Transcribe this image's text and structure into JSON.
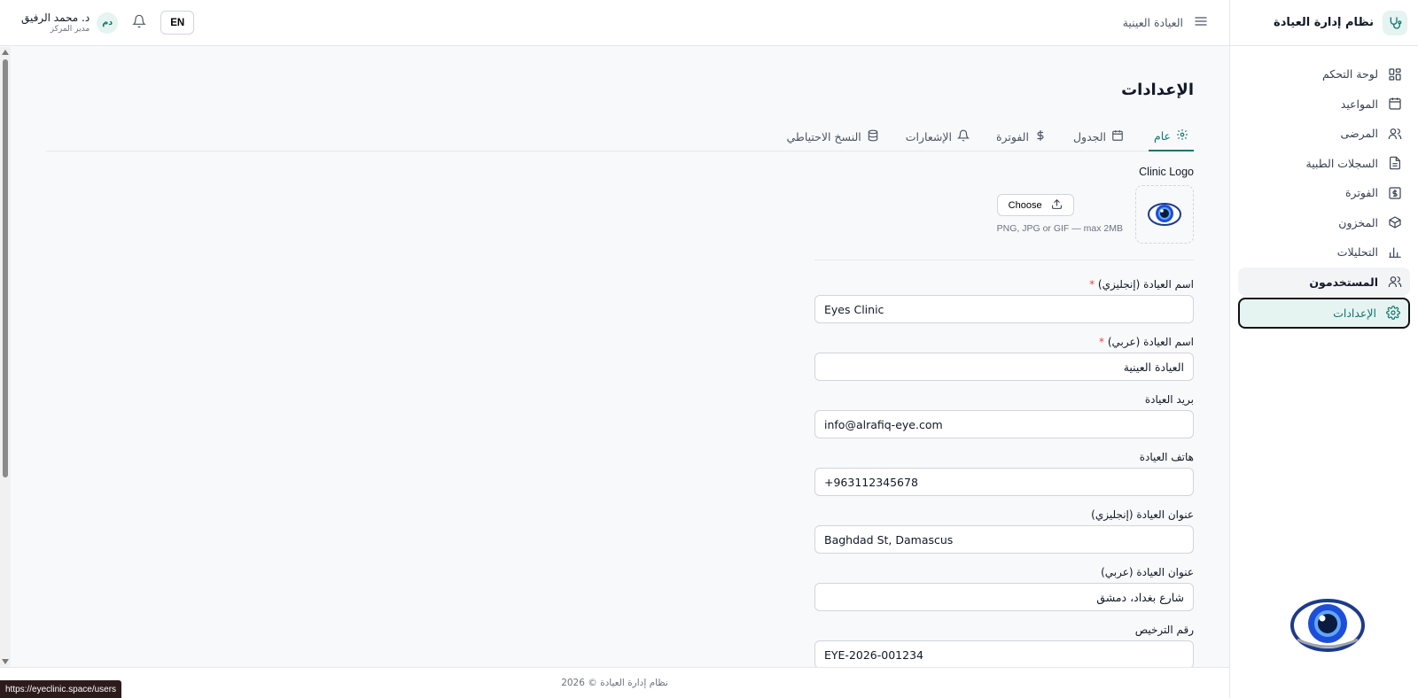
{
  "app": {
    "title": "نظام إدارة العيادة"
  },
  "header": {
    "clinic_name": "العيادة العينية",
    "lang_button": "EN",
    "user": {
      "initials": "دم",
      "name": "د. محمد الرفيق",
      "role": "مدير المركز"
    }
  },
  "sidebar": {
    "items": [
      {
        "label": "لوحة التحكم",
        "icon": "dashboard-icon"
      },
      {
        "label": "المواعيد",
        "icon": "calendar-icon"
      },
      {
        "label": "المرضى",
        "icon": "users-icon"
      },
      {
        "label": "السجلات الطبية",
        "icon": "file-icon"
      },
      {
        "label": "الفوترة",
        "icon": "billing-icon"
      },
      {
        "label": "المخزون",
        "icon": "box-icon"
      },
      {
        "label": "التحليلات",
        "icon": "chart-icon"
      },
      {
        "label": "المستخدمون",
        "icon": "users-icon",
        "state": "hover"
      },
      {
        "label": "الإعدادات",
        "icon": "gear-icon",
        "state": "active"
      }
    ]
  },
  "page": {
    "title": "الإعدادات",
    "tabs": [
      {
        "label": "عام",
        "icon": "gear-icon",
        "active": true
      },
      {
        "label": "الجدول",
        "icon": "calendar-icon"
      },
      {
        "label": "الفوترة",
        "icon": "dollar-icon"
      },
      {
        "label": "الإشعارات",
        "icon": "bell-icon"
      },
      {
        "label": "النسخ الاحتياطي",
        "icon": "database-icon"
      }
    ]
  },
  "form": {
    "logo": {
      "label": "Clinic Logo",
      "choose_label": "Choose",
      "hint": "PNG, JPG or GIF — max 2MB"
    },
    "fields": [
      {
        "label": "اسم العيادة (إنجليزي)",
        "required": "*",
        "value": "Eyes Clinic",
        "dir": "ltr"
      },
      {
        "label": "اسم العيادة (عربي)",
        "required": "*",
        "value": "العيادة العينية",
        "dir": "rtl"
      },
      {
        "label": "بريد العيادة",
        "value": "info@alrafiq-eye.com",
        "dir": "ltr"
      },
      {
        "label": "هاتف العيادة",
        "value": "+963112345678",
        "dir": "ltr"
      },
      {
        "label": "عنوان العيادة (إنجليزي)",
        "value": "Baghdad St, Damascus",
        "dir": "ltr"
      },
      {
        "label": "عنوان العيادة (عربي)",
        "value": "شارع بغداد، دمشق",
        "dir": "rtl"
      },
      {
        "label": "رقم الترخيص",
        "value": "EYE-2026-001234",
        "dir": "ltr"
      }
    ]
  },
  "footer": {
    "text": "نظام إدارة العيادة © 2026"
  },
  "status_url": "https://eyeclinic.space/users",
  "colors": {
    "accent": "#0f766e",
    "accent_bg": "#e6f4f1",
    "required": "#ef4444",
    "logo_blue": "#1e40af"
  }
}
